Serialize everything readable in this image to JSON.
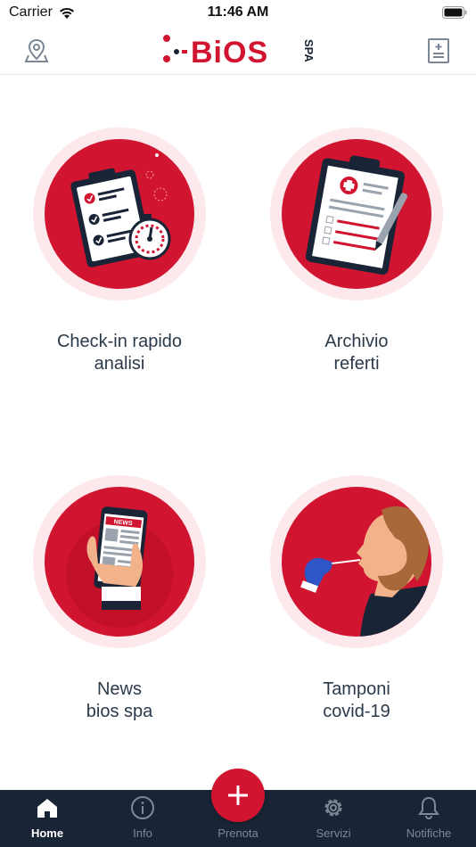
{
  "status_bar": {
    "carrier": "Carrier",
    "time": "11:46 AM"
  },
  "header": {
    "logo_text": "BiOS",
    "logo_suffix": "SPA",
    "left_icon": "map-pin-icon",
    "right_icon": "document-plus-icon"
  },
  "tiles": [
    {
      "line1": "Check-in rapido",
      "line2": "analisi",
      "icon": "clipboard-stopwatch-icon"
    },
    {
      "line1": "Archivio",
      "line2": "referti",
      "icon": "medical-report-icon"
    },
    {
      "line1": "News",
      "line2": "bios spa",
      "icon": "phone-news-icon"
    },
    {
      "line1": "Tamponi",
      "line2": "covid-19",
      "icon": "nasal-swab-icon"
    }
  ],
  "tabbar": {
    "items": [
      {
        "label": "Home",
        "icon": "home-icon",
        "active": true
      },
      {
        "label": "Info",
        "icon": "info-icon",
        "active": false
      },
      {
        "label": "Prenota",
        "icon": "plus-icon",
        "active": false
      },
      {
        "label": "Servizi",
        "icon": "gear-icon",
        "active": false
      },
      {
        "label": "Notifiche",
        "icon": "bell-icon",
        "active": false
      }
    ]
  },
  "colors": {
    "brand_red": "#d1142f",
    "brand_navy": "#192536",
    "tile_ring": "#fde8ec",
    "text": "#2b3a4a"
  }
}
